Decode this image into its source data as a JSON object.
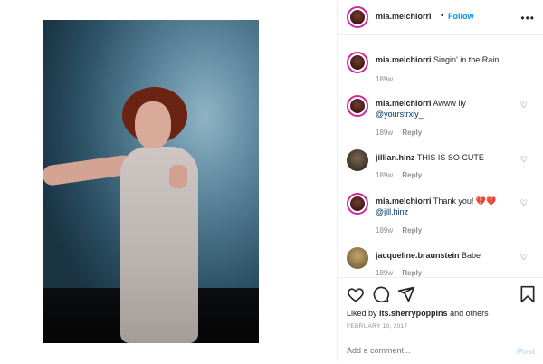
{
  "header": {
    "username": "mia.melchiorri",
    "separator": "•",
    "follow_label": "Follow",
    "more_icon": "more-horizontal-icon"
  },
  "caption": {
    "username": "mia.melchiorri",
    "text": "Singin' in the Rain",
    "time": "189w"
  },
  "comments": [
    {
      "username": "mia.melchiorri",
      "text": "Awww ily",
      "mention": "@yourstrxiy_",
      "time": "189w",
      "reply": "Reply"
    },
    {
      "username": "jillian.hinz",
      "text": "THIS IS SO CUTE",
      "mention": "",
      "time": "189w",
      "reply": "Reply"
    },
    {
      "username": "mia.melchiorri",
      "text": "Thank you! 💔💔",
      "mention": "@jill.hinz",
      "time": "189w",
      "reply": "Reply"
    },
    {
      "username": "jacqueline.braunstein",
      "text": "Babe",
      "mention": "",
      "time": "189w",
      "reply": "Reply"
    }
  ],
  "actions": {
    "likes_prefix": "Liked by",
    "likes_user": "its.sherrypoppins",
    "likes_suffix": "and others",
    "date": "FEBRUARY 10, 2017"
  },
  "add_comment": {
    "placeholder": "Add a comment...",
    "post_label": "Post"
  },
  "colors": {
    "accent": "#0095f6",
    "mention": "#00376b",
    "muted": "#8e8e8e",
    "post_disabled": "#b2dffc"
  }
}
